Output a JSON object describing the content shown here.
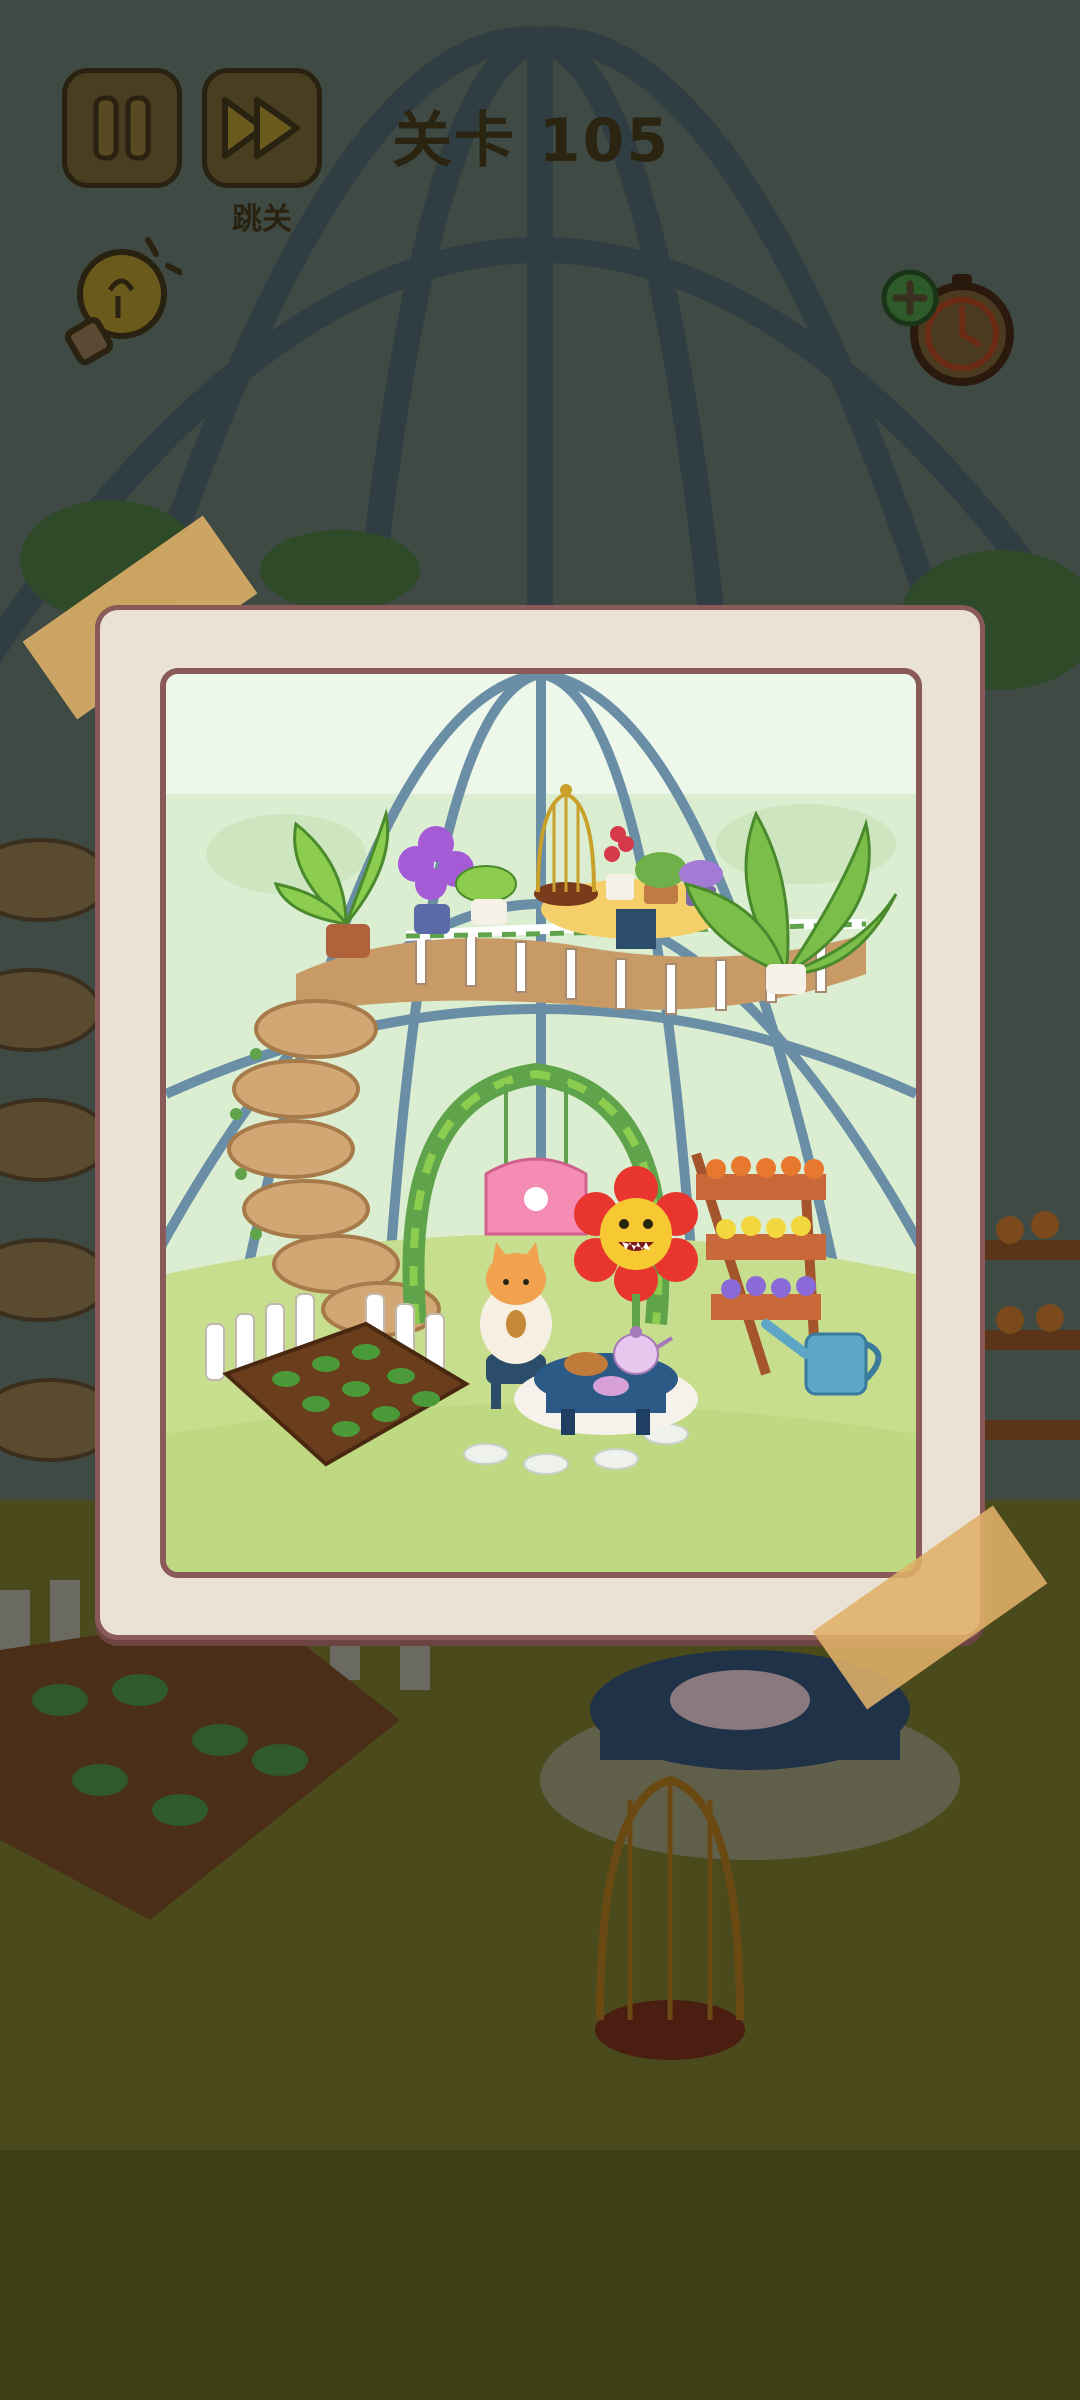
{
  "hud": {
    "pause_icon": "pause-icon",
    "skip_icon": "fast-forward-icon",
    "skip_label": "跳关",
    "level_title": "关卡 105",
    "hint_icon": "lightbulb-hint-icon",
    "add_time_icon": "add-time-clock-icon"
  },
  "scene": {
    "description_icons": [
      "greenhouse-cage",
      "birdcage",
      "tea-table",
      "seedling-bed"
    ]
  },
  "card": {
    "photo_subject": "greenhouse-garden-picture"
  },
  "colors": {
    "accent_brown": "#8a5a58",
    "card_bg": "#ebe2d6",
    "tape": "#e0b068",
    "grass": "#c7de8e"
  }
}
